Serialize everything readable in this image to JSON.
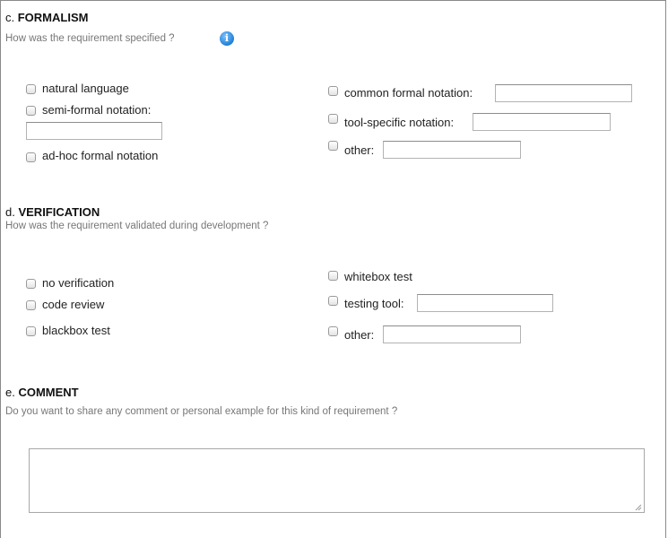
{
  "formalism": {
    "letter": "c. ",
    "title": "FORMALISM",
    "question": "How was the requirement specified ?",
    "info_icon": "info-icon",
    "options": {
      "natural_language": "natural language",
      "semi_formal": "semi-formal notation:",
      "adhoc": "ad-hoc formal notation",
      "common_formal": "common formal notation:",
      "tool_specific": "tool-specific notation:",
      "other": "other:"
    }
  },
  "verification": {
    "letter": "d. ",
    "title": "VERIFICATION",
    "question": "How was the requirement validated during development ?",
    "options": {
      "no_verification": "no verification",
      "code_review": "code review",
      "blackbox": "blackbox test",
      "whitebox": "whitebox test",
      "testing_tool": "testing tool:",
      "other": "other:"
    }
  },
  "comment": {
    "letter": "e. ",
    "title": "COMMENT",
    "question": "Do you want to share any comment or personal example for this kind of requirement ?",
    "value": ""
  }
}
